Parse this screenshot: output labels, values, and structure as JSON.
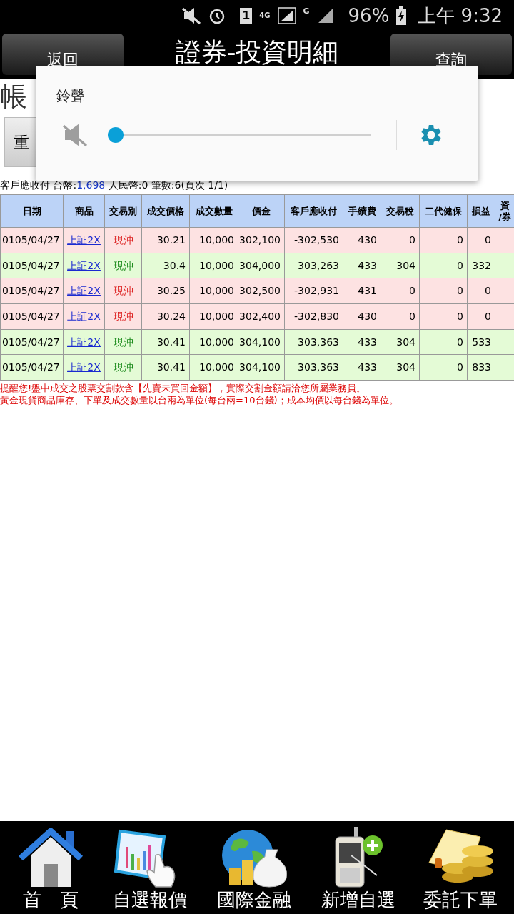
{
  "status_bar": {
    "sim_label": "1",
    "network_1": "4G",
    "network_2": "G",
    "battery": "96%",
    "time": "上午 9:32"
  },
  "header": {
    "back": "返回",
    "title": "證券-投資明細",
    "query": "查詢"
  },
  "behind": {
    "account_label": "帳",
    "reset_button": "重"
  },
  "volume_popup": {
    "title": "鈴聲",
    "muted": true,
    "level": 0
  },
  "summary": {
    "label": "客戶應收付 台幣:",
    "twd": "1,698",
    "rest": " 人民幣:0 筆數:6(頁次 1/1)"
  },
  "table": {
    "columns": [
      "日期",
      "商品",
      "交易別",
      "成交價格",
      "成交數量",
      "價金",
      "客戶應收付",
      "手續費",
      "交易稅",
      "二代健保",
      "損益",
      [
        "資",
        "/券"
      ]
    ],
    "rows": [
      {
        "kind": "red",
        "cells": [
          "0105/04/27",
          "上証2X",
          "現沖",
          "30.21",
          "10,000",
          "302,100",
          "-302,530",
          "430",
          "0",
          "0",
          "0"
        ]
      },
      {
        "kind": "green",
        "cells": [
          "0105/04/27",
          "上証2X",
          "現沖",
          "30.4",
          "10,000",
          "304,000",
          "303,263",
          "433",
          "304",
          "0",
          "332"
        ]
      },
      {
        "kind": "red",
        "cells": [
          "0105/04/27",
          "上証2X",
          "現沖",
          "30.25",
          "10,000",
          "302,500",
          "-302,931",
          "431",
          "0",
          "0",
          "0"
        ]
      },
      {
        "kind": "red",
        "cells": [
          "0105/04/27",
          "上証2X",
          "現沖",
          "30.24",
          "10,000",
          "302,400",
          "-302,830",
          "430",
          "0",
          "0",
          "0"
        ]
      },
      {
        "kind": "green",
        "cells": [
          "0105/04/27",
          "上証2X",
          "現沖",
          "30.41",
          "10,000",
          "304,100",
          "303,363",
          "433",
          "304",
          "0",
          "533"
        ]
      },
      {
        "kind": "green",
        "cells": [
          "0105/04/27",
          "上証2X",
          "現沖",
          "30.41",
          "10,000",
          "304,100",
          "303,363",
          "433",
          "304",
          "0",
          "833"
        ]
      }
    ]
  },
  "notes": [
    "提醒您!盤中成交之股票交割款含【先賣未買回金額】，實際交割金額請洽您所屬業務員。",
    "黃金現貨商品庫存、下單及成交數量以台兩為單位(每台兩=10台錢)；成本均價以每台錢為單位。"
  ],
  "nav": [
    {
      "kind": "home",
      "label": "首　頁"
    },
    {
      "kind": "quotes",
      "label": "自選報價"
    },
    {
      "kind": "global",
      "label": "國際金融"
    },
    {
      "kind": "add",
      "label": "新增自選"
    },
    {
      "kind": "order",
      "label": "委託下單"
    }
  ]
}
